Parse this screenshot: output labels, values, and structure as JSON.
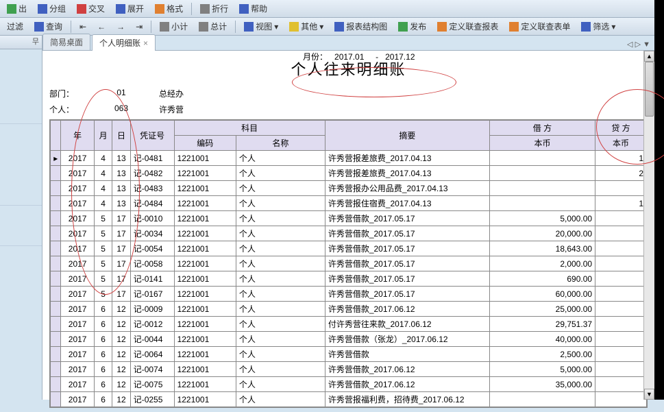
{
  "toolbar1": {
    "export": "出",
    "group": "分组",
    "cross": "交叉",
    "expand": "展开",
    "format": "格式",
    "wrap": "折行",
    "help": "帮助"
  },
  "toolbar2": {
    "filter": "过滤",
    "query": "查询",
    "subtotal": "小计",
    "total": "总计",
    "view": "视图",
    "other": "其他",
    "struct": "报表结构图",
    "publish": "发布",
    "defreport": "定义联查报表",
    "defform": "定义联查表单",
    "filter2": "筛选"
  },
  "tabs": {
    "simple": "简易桌面",
    "detail": "个人明细账"
  },
  "report": {
    "title": "个人往来明细账",
    "dept_label": "部门：",
    "dept_code": "01",
    "dept_name": "总经办",
    "person_label": "个人：",
    "person_code": "063",
    "person_name": "许秀营",
    "month_label": "月份：",
    "month_from": "2017.01",
    "month_sep": "-",
    "month_to": "2017.12"
  },
  "columns": {
    "year": "年",
    "month": "月",
    "day": "日",
    "voucher": "凭证号",
    "subject": "科目",
    "subject_code": "编码",
    "subject_name": "名称",
    "summary": "摘要",
    "debit": "借 方",
    "debit_local": "本币",
    "credit": "贷 方",
    "credit_local": "本币"
  },
  "rows": [
    {
      "y": "2017",
      "m": "4",
      "d": "13",
      "v": "记-0481",
      "code": "1221001",
      "name": "个人",
      "sum": "许秀营报差旅费_2017.04.13",
      "deb": "",
      "cre": "1"
    },
    {
      "y": "2017",
      "m": "4",
      "d": "13",
      "v": "记-0482",
      "code": "1221001",
      "name": "个人",
      "sum": "许秀营报差旅费_2017.04.13",
      "deb": "",
      "cre": "2"
    },
    {
      "y": "2017",
      "m": "4",
      "d": "13",
      "v": "记-0483",
      "code": "1221001",
      "name": "个人",
      "sum": "许秀营报办公用品费_2017.04.13",
      "deb": "",
      "cre": ""
    },
    {
      "y": "2017",
      "m": "4",
      "d": "13",
      "v": "记-0484",
      "code": "1221001",
      "name": "个人",
      "sum": "许秀营报住宿费_2017.04.13",
      "deb": "",
      "cre": "1"
    },
    {
      "y": "2017",
      "m": "5",
      "d": "17",
      "v": "记-0010",
      "code": "1221001",
      "name": "个人",
      "sum": "许秀营借款_2017.05.17",
      "deb": "5,000.00",
      "cre": ""
    },
    {
      "y": "2017",
      "m": "5",
      "d": "17",
      "v": "记-0034",
      "code": "1221001",
      "name": "个人",
      "sum": "许秀营借款_2017.05.17",
      "deb": "20,000.00",
      "cre": ""
    },
    {
      "y": "2017",
      "m": "5",
      "d": "17",
      "v": "记-0054",
      "code": "1221001",
      "name": "个人",
      "sum": "许秀营借款_2017.05.17",
      "deb": "18,643.00",
      "cre": ""
    },
    {
      "y": "2017",
      "m": "5",
      "d": "17",
      "v": "记-0058",
      "code": "1221001",
      "name": "个人",
      "sum": "许秀营借款_2017.05.17",
      "deb": "2,000.00",
      "cre": ""
    },
    {
      "y": "2017",
      "m": "5",
      "d": "17",
      "v": "记-0141",
      "code": "1221001",
      "name": "个人",
      "sum": "许秀营借款_2017.05.17",
      "deb": "690.00",
      "cre": ""
    },
    {
      "y": "2017",
      "m": "5",
      "d": "17",
      "v": "记-0167",
      "code": "1221001",
      "name": "个人",
      "sum": "许秀营借款_2017.05.17",
      "deb": "60,000.00",
      "cre": ""
    },
    {
      "y": "2017",
      "m": "6",
      "d": "12",
      "v": "记-0009",
      "code": "1221001",
      "name": "个人",
      "sum": "许秀营借款_2017.06.12",
      "deb": "25,000.00",
      "cre": ""
    },
    {
      "y": "2017",
      "m": "6",
      "d": "12",
      "v": "记-0012",
      "code": "1221001",
      "name": "个人",
      "sum": "付许秀营往来款_2017.06.12",
      "deb": "29,751.37",
      "cre": ""
    },
    {
      "y": "2017",
      "m": "6",
      "d": "12",
      "v": "记-0044",
      "code": "1221001",
      "name": "个人",
      "sum": "许秀营借款（张龙）_2017.06.12",
      "deb": "40,000.00",
      "cre": ""
    },
    {
      "y": "2017",
      "m": "6",
      "d": "12",
      "v": "记-0064",
      "code": "1221001",
      "name": "个人",
      "sum": "许秀营借款",
      "deb": "2,500.00",
      "cre": ""
    },
    {
      "y": "2017",
      "m": "6",
      "d": "12",
      "v": "记-0074",
      "code": "1221001",
      "name": "个人",
      "sum": "许秀营借款_2017.06.12",
      "deb": "5,000.00",
      "cre": ""
    },
    {
      "y": "2017",
      "m": "6",
      "d": "12",
      "v": "记-0075",
      "code": "1221001",
      "name": "个人",
      "sum": "许秀营借款_2017.06.12",
      "deb": "35,000.00",
      "cre": ""
    },
    {
      "y": "2017",
      "m": "6",
      "d": "12",
      "v": "记-0255",
      "code": "1221001",
      "name": "个人",
      "sum": "许秀营报福利费，招待费_2017.06.12",
      "deb": "",
      "cre": ""
    }
  ],
  "nav": {
    "prev": "◁",
    "next": "▷",
    "down": "▼"
  }
}
